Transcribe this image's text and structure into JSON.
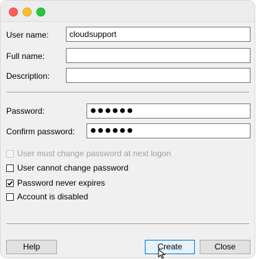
{
  "window": {
    "controls": [
      "close",
      "minimize",
      "zoom"
    ]
  },
  "form": {
    "user_name_label": "User name:",
    "user_name_value": "cloudsupport",
    "full_name_label": "Full name:",
    "full_name_value": "",
    "description_label": "Description:",
    "description_value": "",
    "password_label": "Password:",
    "password_value": "●●●●●●",
    "confirm_label": "Confirm password:",
    "confirm_value": "●●●●●●"
  },
  "options": [
    {
      "label": "User must change password at next logon",
      "checked": false,
      "enabled": false
    },
    {
      "label": "User cannot change password",
      "checked": false,
      "enabled": true
    },
    {
      "label": "Password never expires",
      "checked": true,
      "enabled": true
    },
    {
      "label": "Account is disabled",
      "checked": false,
      "enabled": true
    }
  ],
  "buttons": {
    "help": "Help",
    "create": "Create",
    "close": "Close"
  },
  "colors": {
    "titlebar": "#ececec",
    "dialog_bg": "#f0f0f0",
    "default_button_border": "#0078d7",
    "close_light": "#fe5f57",
    "minimize_light": "#febc2e",
    "zoom_light": "#28c840"
  }
}
